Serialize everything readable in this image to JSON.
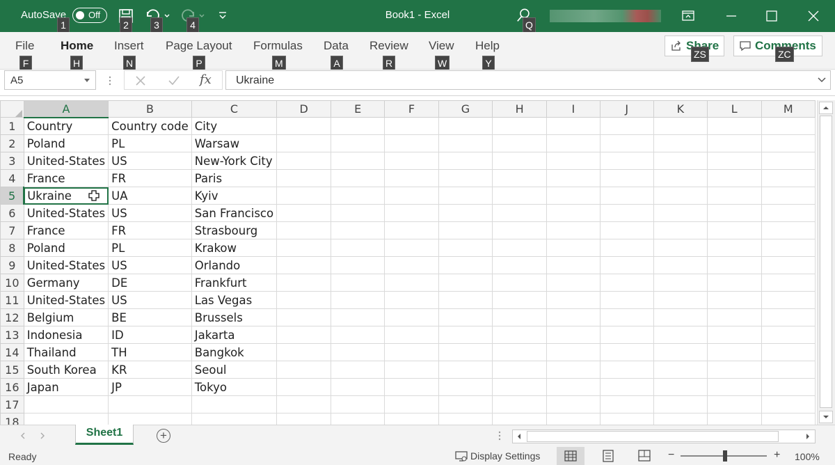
{
  "window": {
    "autosave_label": "AutoSave",
    "autosave_state": "Off",
    "title": "Book1  -  Excel",
    "accent": "#217346"
  },
  "quick_access_keytips": [
    "1",
    "2",
    "3",
    "4"
  ],
  "search_keytip": "Q",
  "ribbon": {
    "tabs": [
      {
        "label": "File",
        "keytip": "F"
      },
      {
        "label": "Home",
        "keytip": "H",
        "active": true
      },
      {
        "label": "Insert",
        "keytip": "N"
      },
      {
        "label": "Page Layout",
        "keytip": "P"
      },
      {
        "label": "Formulas",
        "keytip": "M"
      },
      {
        "label": "Data",
        "keytip": "A"
      },
      {
        "label": "Review",
        "keytip": "R"
      },
      {
        "label": "View",
        "keytip": "W"
      },
      {
        "label": "Help",
        "keytip": "Y"
      }
    ],
    "share": {
      "label": "Share",
      "keytip": "ZS"
    },
    "comments": {
      "label": "Comments",
      "keytip": "ZC"
    }
  },
  "formula_bar": {
    "name_box": "A5",
    "fx_label": "fx",
    "value": "Ukraine"
  },
  "sheet": {
    "columns": [
      "A",
      "B",
      "C",
      "D",
      "E",
      "F",
      "G",
      "H",
      "I",
      "J",
      "K",
      "L",
      "M"
    ],
    "row_numbers": [
      "1",
      "2",
      "3",
      "4",
      "5",
      "6",
      "7",
      "8",
      "9",
      "10",
      "11",
      "12",
      "13",
      "14",
      "15",
      "16",
      "17",
      "18"
    ],
    "rows": [
      [
        "Country",
        "Country code",
        "City"
      ],
      [
        "Poland",
        "PL",
        "Warsaw"
      ],
      [
        "United-States",
        "US",
        "New-York City"
      ],
      [
        "France",
        "FR",
        "Paris"
      ],
      [
        "Ukraine",
        "UA",
        "Kyiv"
      ],
      [
        "United-States",
        "US",
        "San Francisco"
      ],
      [
        "France",
        "FR",
        "Strasbourg"
      ],
      [
        "Poland",
        "PL",
        "Krakow"
      ],
      [
        "United-States",
        "US",
        "Orlando"
      ],
      [
        "Germany",
        "DE",
        "Frankfurt"
      ],
      [
        "United-States",
        "US",
        "Las Vegas"
      ],
      [
        "Belgium",
        "BE",
        "Brussels"
      ],
      [
        "Indonesia",
        "ID",
        "Jakarta"
      ],
      [
        "Thailand",
        "TH",
        "Bangkok"
      ],
      [
        "South Korea",
        "KR",
        "Seoul"
      ],
      [
        "Japan",
        "JP",
        "Tokyo"
      ],
      [
        "",
        "",
        ""
      ],
      [
        "",
        "",
        ""
      ]
    ],
    "active_cell": "A5",
    "tab_name": "Sheet1",
    "add_sheet": "+"
  },
  "status": {
    "ready": "Ready",
    "display_settings": "Display Settings",
    "zoom": "100%",
    "zoom_minus": "−",
    "zoom_plus": "+"
  }
}
